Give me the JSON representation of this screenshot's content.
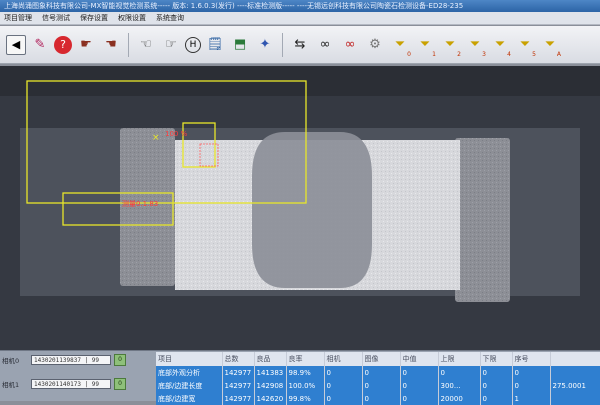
{
  "window": {
    "title": "上海尚涌图象科技有限公司-MX智能视觉检测系统----- 版本: 1.6.0.3(发行)   ----标准检测版-----   ----无锡远创科技有限公司陶瓷石检测设备-ED28-235"
  },
  "menu": [
    "项目管理",
    "信号测试",
    "保存设置",
    "权限设置",
    "系统查询"
  ],
  "toolbar": {
    "icons": [
      "back-icon",
      "edit-icon",
      "help-icon",
      "pointer-icon",
      "pointer-alt-icon",
      "hand-icon",
      "hand-alt-icon",
      "help-box-icon",
      "note-icon",
      "image-edit-icon",
      "palette-icon",
      "swap-icon",
      "binoculars-icon",
      "binoculars-red-icon",
      "gear-icon",
      "filter-0-icon",
      "filter-1-icon",
      "filter-2-icon",
      "filter-3-icon",
      "filter-4-icon",
      "filter-5-icon",
      "filter-a-icon"
    ],
    "filter_numbers": [
      "0",
      "1",
      "2",
      "3",
      "4",
      "5",
      "A"
    ],
    "help_box_label": "H"
  },
  "camera_view": {
    "roi_percent_label": "100 %",
    "roi_label_2": "测量0.1.83"
  },
  "cameras": [
    {
      "label": "相机0",
      "value": "1430201139837 | 99",
      "button": "0"
    },
    {
      "label": "相机1",
      "value": "1430201140173 | 99",
      "button": "0"
    }
  ],
  "table": {
    "headers": [
      "项目",
      "总数",
      "良品",
      "良率",
      "相机",
      "图像",
      "中值",
      "上限",
      "下限",
      "序号",
      ""
    ],
    "rows": [
      [
        "底部外观分析",
        "142977",
        "141383",
        "98.9%",
        "0",
        "0",
        "0",
        "0",
        "0",
        "0",
        ""
      ],
      [
        "底部/边建长度",
        "142977",
        "142908",
        "100.0%",
        "0",
        "0",
        "0",
        "300...",
        "0",
        "0",
        "275.0001"
      ],
      [
        "底部/边建宽",
        "142977",
        "142620",
        "99.8%",
        "0",
        "0",
        "0",
        "20000",
        "0",
        "1",
        ""
      ]
    ]
  },
  "colors": {
    "roi": "#e8e62a",
    "roi_red": "#ff3b3b",
    "selected_row": "#2f7fd0",
    "value_highlight": "#7cd06f"
  }
}
